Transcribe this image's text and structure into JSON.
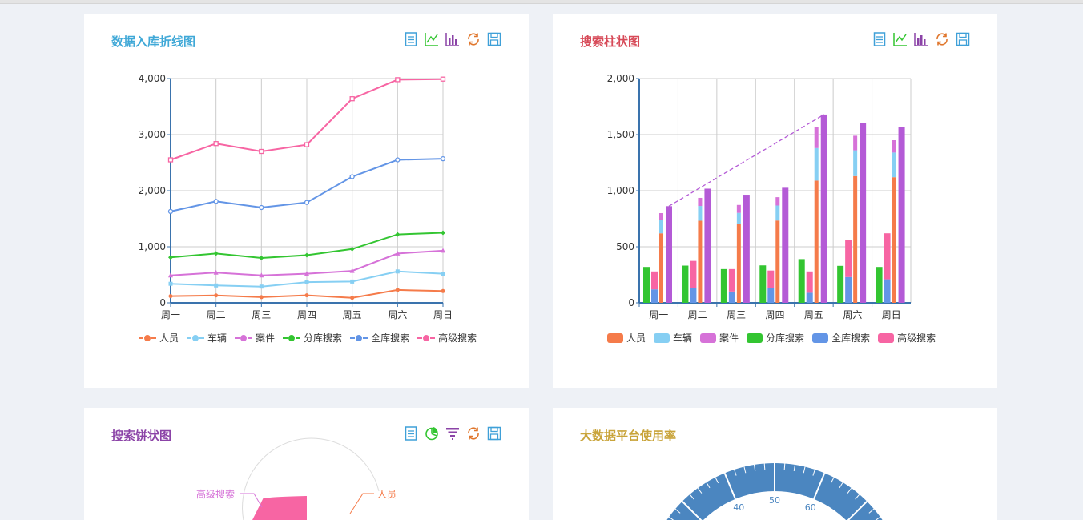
{
  "colors": {
    "person": "#f57b4a",
    "vehicle": "#86cff3",
    "case": "#d672d8",
    "branch_search": "#33c531",
    "full_search": "#6395e6",
    "advanced_search": "#f765a3",
    "extra_series": "#b45ad6"
  },
  "panels": {
    "line": {
      "title": "数据入库折线图",
      "title_color": "#3fa8d7",
      "tools": [
        "data-view-icon",
        "line-chart-icon",
        "bar-chart-icon",
        "refresh-icon",
        "save-icon"
      ]
    },
    "bar": {
      "title": "搜索柱状图",
      "title_color": "#d74a58",
      "tools": [
        "data-view-icon",
        "line-chart-icon",
        "bar-chart-icon",
        "refresh-icon",
        "save-icon"
      ]
    },
    "pie": {
      "title": "搜索饼状图",
      "title_color": "#8b43a7",
      "tools": [
        "data-view-icon",
        "pie-chart-icon",
        "funnel-icon",
        "refresh-icon",
        "save-icon"
      ],
      "labels": {
        "left": "高级搜索",
        "right": "人员"
      }
    },
    "gauge": {
      "title": "大数据平台使用率",
      "title_color": "#c9a43a",
      "ticks": [
        "40",
        "50",
        "60"
      ]
    }
  },
  "chart_data": [
    {
      "type": "line",
      "categories": [
        "周一",
        "周二",
        "周三",
        "周四",
        "周五",
        "周六",
        "周日"
      ],
      "ylim": [
        0,
        4000
      ],
      "yticks": [
        0,
        1000,
        2000,
        3000,
        4000
      ],
      "ytick_labels": [
        "0",
        "1,000",
        "2,000",
        "3,000",
        "4,000"
      ],
      "grid": true,
      "legend_position": "bottom",
      "series": [
        {
          "name": "人员",
          "values": [
            120,
            132,
            101,
            134,
            90,
            230,
            210
          ]
        },
        {
          "name": "车辆",
          "values": [
            340,
            310,
            290,
            370,
            380,
            560,
            520
          ]
        },
        {
          "name": "案件",
          "values": [
            490,
            540,
            490,
            520,
            570,
            880,
            930
          ]
        },
        {
          "name": "分库搜索",
          "values": [
            810,
            880,
            800,
            850,
            960,
            1220,
            1250
          ]
        },
        {
          "name": "全库搜索",
          "values": [
            1630,
            1810,
            1700,
            1790,
            2250,
            2550,
            2570
          ]
        },
        {
          "name": "高级搜索",
          "values": [
            2550,
            2840,
            2700,
            2820,
            3640,
            3980,
            3990
          ]
        }
      ]
    },
    {
      "type": "bar",
      "categories": [
        "周一",
        "周二",
        "周三",
        "周四",
        "周五",
        "周六",
        "周日"
      ],
      "ylim": [
        0,
        2000
      ],
      "yticks": [
        0,
        500,
        1000,
        1500,
        2000
      ],
      "ytick_labels": [
        "0",
        "500",
        "1,000",
        "1,500",
        "2,000"
      ],
      "grid": true,
      "legend_position": "bottom",
      "series": [
        {
          "name": "分库搜索",
          "values": [
            320,
            332,
            301,
            334,
            390,
            330,
            320
          ]
        },
        {
          "name": "全库搜索",
          "values": [
            120,
            132,
            101,
            134,
            90,
            230,
            210
          ]
        },
        {
          "name": "高级搜索",
          "values": [
            160,
            242,
            200,
            154,
            190,
            330,
            410
          ]
        },
        {
          "name": "人员",
          "values": [
            620,
            732,
            701,
            734,
            1090,
            1130,
            1120
          ]
        },
        {
          "name": "车辆",
          "values": [
            120,
            132,
            101,
            134,
            290,
            230,
            220
          ]
        },
        {
          "name": "案件",
          "values": [
            60,
            72,
            71,
            74,
            190,
            130,
            110
          ]
        },
        {
          "values": [
            862,
            1018,
            964,
            1026,
            1679,
            1600,
            1570
          ]
        }
      ],
      "trend_line": {
        "from_index": 0,
        "to_index": 4,
        "from_value": 862,
        "to_value": 1679
      }
    }
  ]
}
